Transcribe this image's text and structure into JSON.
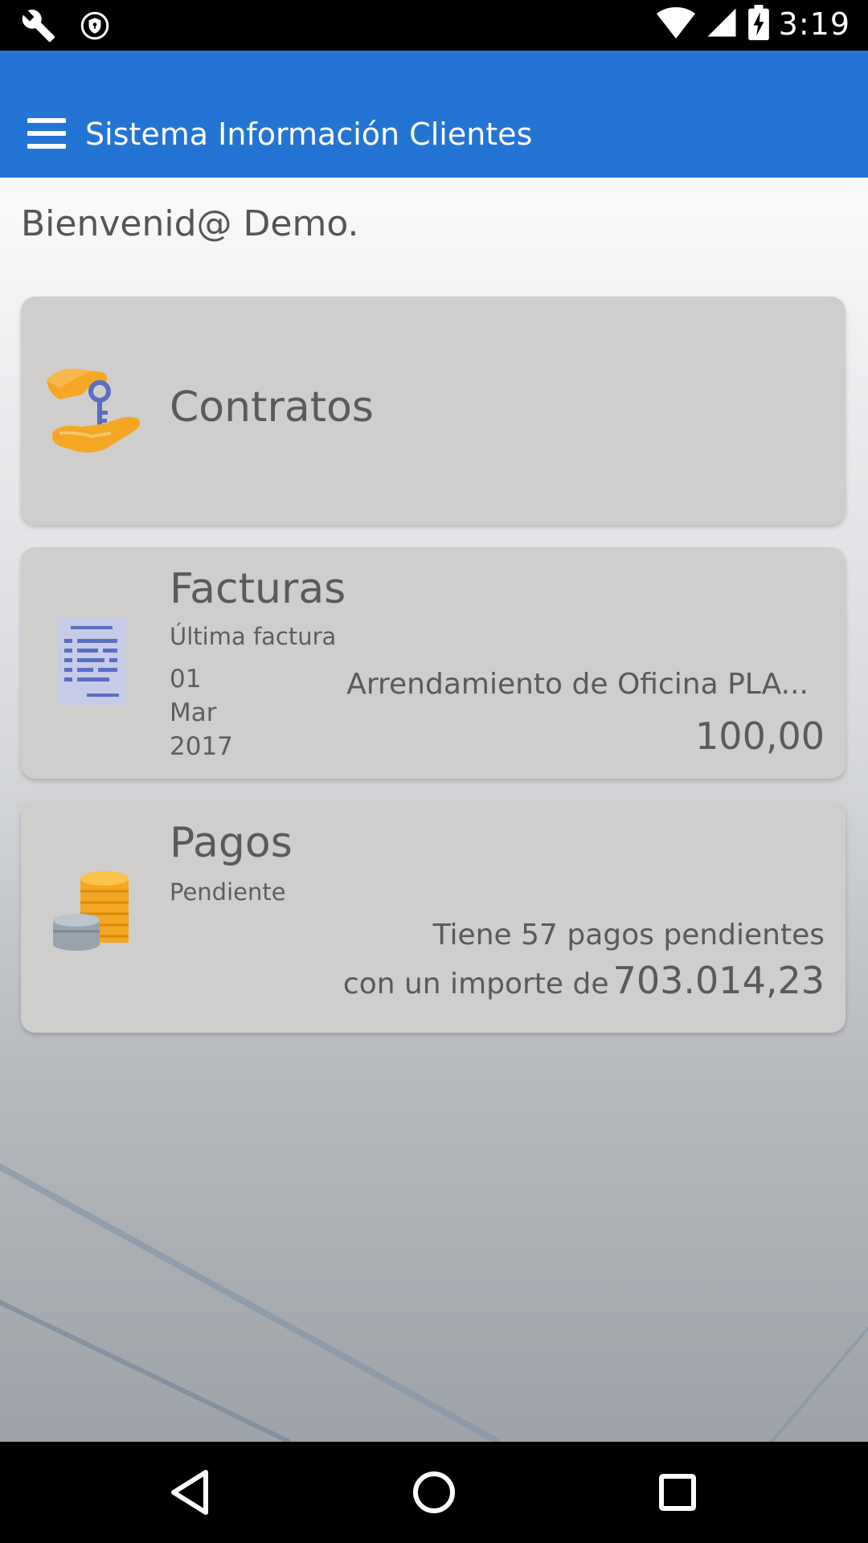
{
  "status_bar": {
    "time": "3:19",
    "icons": [
      "wrench-icon",
      "shield-icon",
      "wifi-icon",
      "signal-icon",
      "battery-charging-icon"
    ]
  },
  "app_bar": {
    "title": "Sistema Información Clientes",
    "menu_icon": "hamburger-menu-icon",
    "color": "#2475d3"
  },
  "welcome_text": "Bienvenid@ Demo.",
  "cards": {
    "contratos": {
      "title": "Contratos",
      "icon": "hand-key-icon"
    },
    "facturas": {
      "title": "Facturas",
      "subtitle": "Última factura",
      "date_day": "01",
      "date_month": "Mar",
      "date_year": "2017",
      "description": "Arrendamiento de Oficina  PLA...",
      "amount": "100,00",
      "icon": "invoice-document-icon"
    },
    "pagos": {
      "title": "Pagos",
      "subtitle": "Pendiente",
      "line1": "Tiene 57 pagos pendientes",
      "line2_prefix": "con un importe de",
      "amount": "703.014,23",
      "icon": "coins-stack-icon"
    }
  },
  "nav_bar": {
    "buttons": [
      "back-icon",
      "home-icon",
      "recents-icon"
    ]
  }
}
